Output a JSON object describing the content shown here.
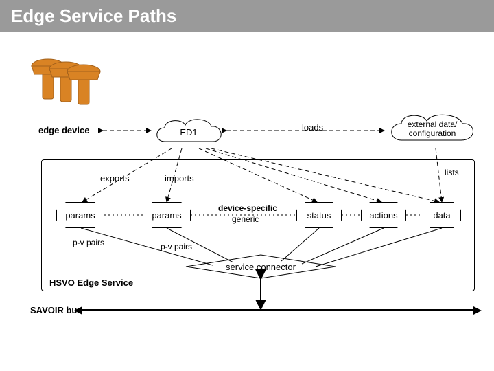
{
  "title": "Edge Service Paths",
  "labels": {
    "edge_device": "edge device",
    "loads": "loads",
    "exports": "exports",
    "imports": "imports",
    "device_specific": "device-specific",
    "generic": "generic",
    "pv_pairs_1": "p-v pairs",
    "pv_pairs_2": "p-v pairs",
    "lists": "lists",
    "hsvo": "HSVO Edge Service",
    "savoir": "SAVOIR bus"
  },
  "nodes": {
    "ed1": "ED1",
    "ext_data": "external data/\nconfiguration",
    "params1": "params",
    "params2": "params",
    "status": "status",
    "actions": "actions",
    "data": "data",
    "connector": "service connector"
  },
  "colors": {
    "title_bg": "#9a9a9a",
    "orange": "#d98324"
  }
}
